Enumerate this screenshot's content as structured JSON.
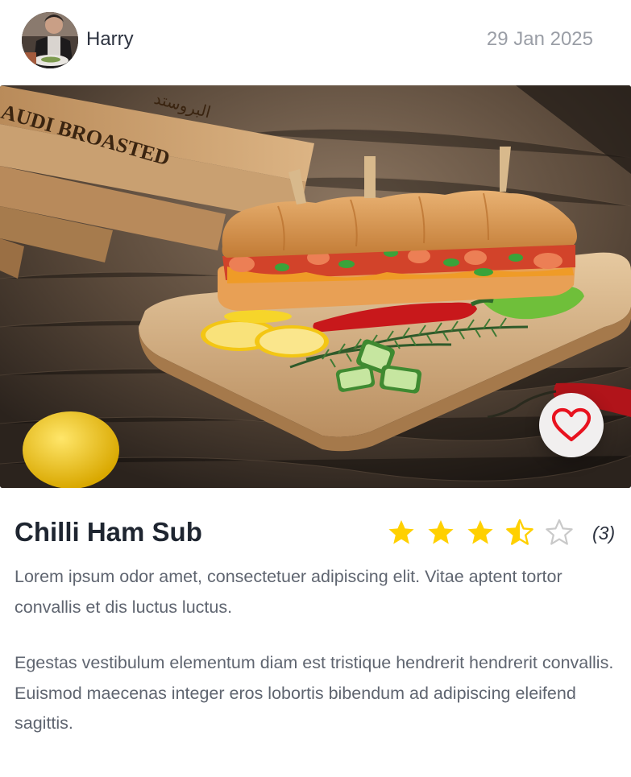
{
  "post": {
    "author": "Harry",
    "date": "29 Jan 2025",
    "avatar_icon": "chef-avatar",
    "image_icon": "sandwich-photo",
    "image_text": [
      "AUDI BROASTED",
      "البروستد"
    ],
    "favorite_icon": "heart-icon",
    "title": "Chilli Ham Sub",
    "rating": 3.5,
    "rating_max": 5,
    "rating_count": "(3)",
    "star_color": "#ffd000",
    "star_empty_color": "#c9c9c9",
    "heart_color": "#e8121f",
    "paragraphs": [
      "Lorem ipsum odor amet, consectetuer adipiscing elit. Vitae aptent tortor convallis et dis luctus luctus.",
      "Egestas vestibulum elementum diam est tristique hendrerit hendrerit convallis. Euismod maecenas integer eros lobortis bibendum ad adipiscing eleifend sagittis."
    ]
  }
}
